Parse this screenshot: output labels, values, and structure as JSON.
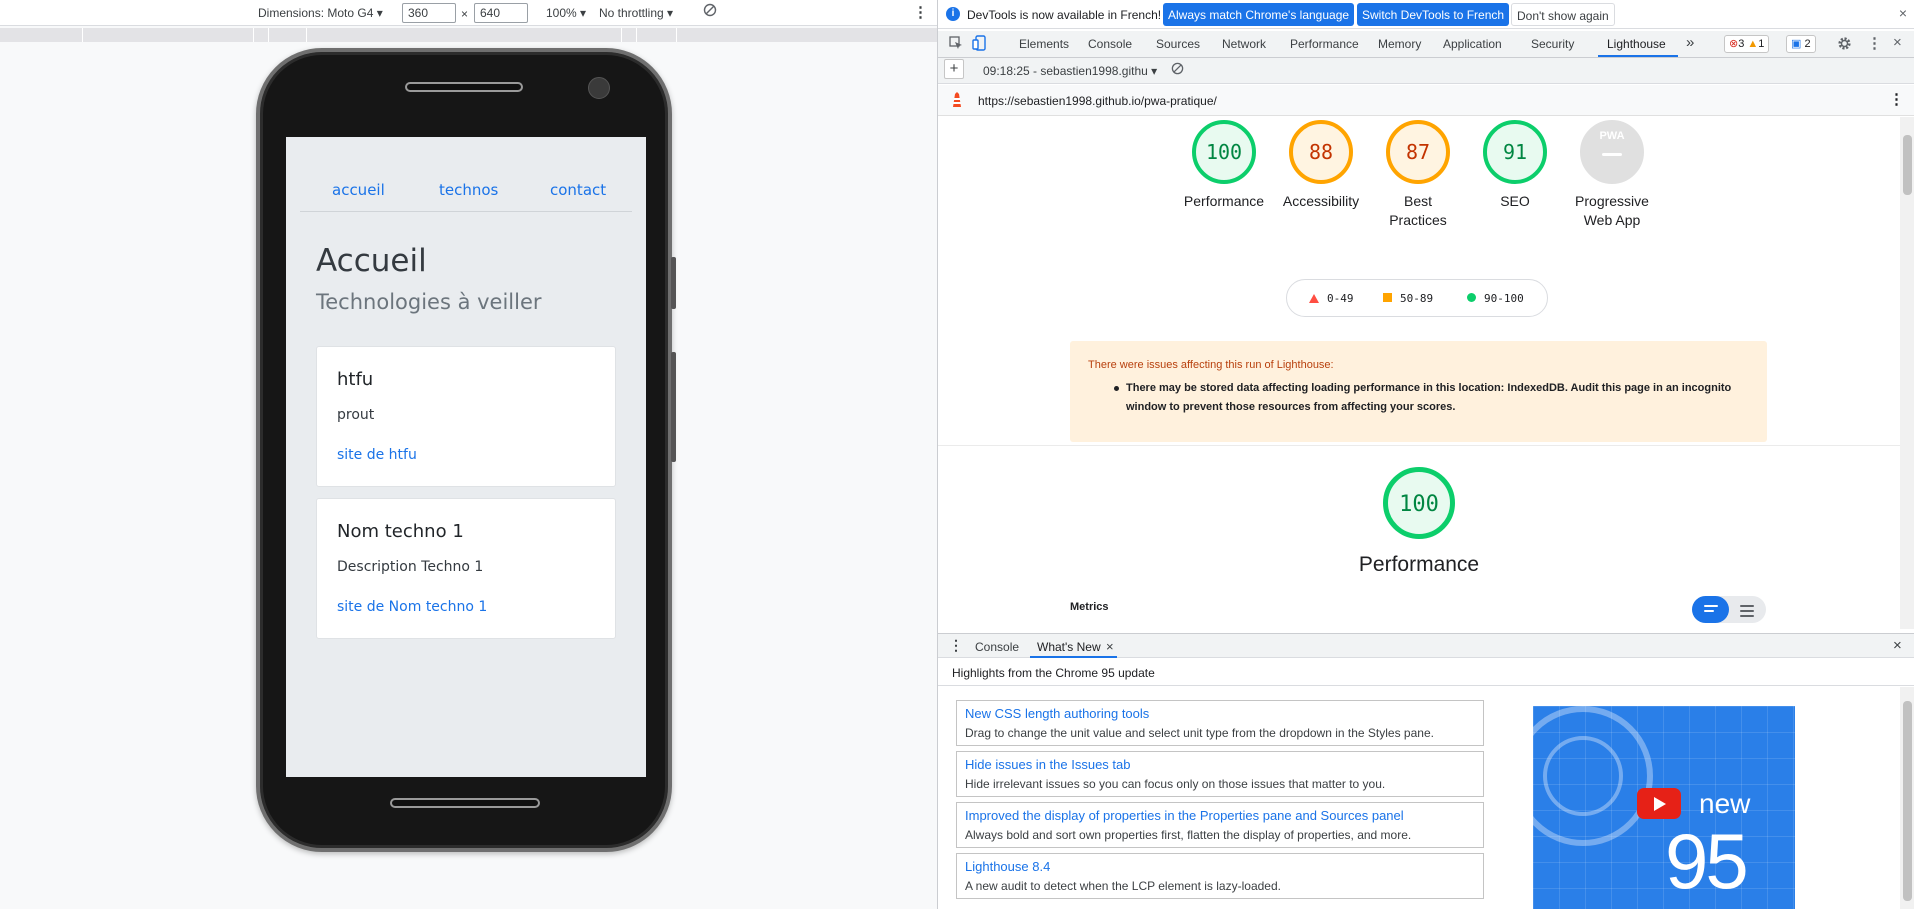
{
  "device_toolbar": {
    "dimensions_label": "Dimensions: Moto G4 ▾",
    "width": "360",
    "times": "×",
    "height": "640",
    "zoom": "100% ▾",
    "throttling": "No throttling ▾",
    "no_rotate_icon": "rotate-disabled-icon",
    "more_icon": "more-vertical-icon"
  },
  "site": {
    "nav": [
      "accueil",
      "technos",
      "contact"
    ],
    "title": "Accueil",
    "subtitle": "Technologies à veiller",
    "cards": [
      {
        "title": "htfu",
        "description": "prout",
        "link": "site de htfu"
      },
      {
        "title": "Nom techno 1",
        "description": "Description Techno 1",
        "link": "site de Nom techno 1"
      }
    ]
  },
  "infobar": {
    "message": "DevTools is now available in French!",
    "btn_match": "Always match Chrome's language",
    "btn_switch": "Switch DevTools to French",
    "btn_dismiss": "Don't show again",
    "close": "×"
  },
  "devtools_tabs": {
    "items": [
      "Elements",
      "Console",
      "Sources",
      "Network",
      "Performance",
      "Memory",
      "Application",
      "Security",
      "Lighthouse"
    ],
    "active": "Lighthouse",
    "more": "»",
    "errors": "3",
    "warnings": "1",
    "issues": "2",
    "close": "×"
  },
  "lighthouse_toolbar": {
    "add": "+",
    "report_select": "09:18:25 - sebastien1998.githu ▾",
    "url": "https://sebastien1998.github.io/pwa-pratique/"
  },
  "report": {
    "gauges": [
      {
        "label": "Performance",
        "score": "100",
        "rating": "green"
      },
      {
        "label": "Accessibility",
        "score": "88",
        "rating": "orange"
      },
      {
        "label": "Best Practices",
        "score": "87",
        "rating": "orange"
      },
      {
        "label": "SEO",
        "score": "91",
        "rating": "green"
      },
      {
        "label": "Progressive Web App",
        "score": "",
        "rating": "grey"
      }
    ],
    "pwa_badge": "PWA",
    "legend": [
      "0-49",
      "50-89",
      "90-100"
    ],
    "warning_title": "There were issues affecting this run of Lighthouse:",
    "warning_item": "There may be stored data affecting loading performance in this location: IndexedDB. Audit this page in an incognito window to prevent those resources from affecting your scores.",
    "perf_score": "100",
    "perf_title": "Performance",
    "metrics_label": "Metrics"
  },
  "drawer": {
    "tabs": [
      "Console",
      "What's New"
    ],
    "active": "What's New",
    "close": "×",
    "subtitle": "Highlights from the Chrome 95 update",
    "items": [
      {
        "title": "New CSS length authoring tools",
        "desc": "Drag to change the unit value and select unit type from the dropdown in the Styles pane."
      },
      {
        "title": "Hide issues in the Issues tab",
        "desc": "Hide irrelevant issues so you can focus only on those issues that matter to you."
      },
      {
        "title": "Improved the display of properties in the Properties pane and Sources panel",
        "desc": "Always bold and sort own properties first, flatten the display of properties, and more."
      },
      {
        "title": "Lighthouse 8.4",
        "desc": "A new audit to detect when the LCP element is lazy-loaded."
      }
    ],
    "video_new": "new",
    "video_num": "95"
  }
}
